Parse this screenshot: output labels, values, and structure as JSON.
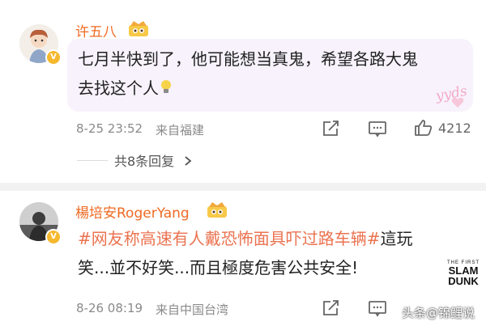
{
  "comments": [
    {
      "username": "许五八",
      "text_line1": "七月半快到了，他可能想当真鬼，希望各路大鬼",
      "text_line2": "去找这个人",
      "sticker": "yyds",
      "timestamp": "8-25 23:52",
      "location": "来自福建",
      "like_count": "4212",
      "replies_label": "共8条回复",
      "badge": "V"
    },
    {
      "username": "楊培安RogerYang",
      "hashtag": "#网友称高速有人戴恐怖面具吓过路车辆#",
      "text_after_hashtag": "這玩",
      "text_line2": "笑...並不好笑...而且極度危害公共安全!",
      "timestamp": "8-26 08:19",
      "location": "来自中国台湾",
      "badge": "V"
    }
  ],
  "icons": {
    "share": "share-icon",
    "comment": "comment-icon",
    "like": "thumbs-up-icon",
    "bulb": "lightbulb-emoji-icon",
    "crown": "vip-crown-icon",
    "chevron": "chevron-right-icon"
  },
  "watermark": {
    "text": "头条@锦鲤说"
  },
  "slamdunk_logo": {
    "line1": "THE FIRST",
    "line2": "SLAM",
    "line3": "DUNK"
  },
  "colors": {
    "username": "#ef6a22",
    "hashtag": "#eb7350",
    "bubble": "#f7f2fc",
    "badge": "#f5b82e"
  }
}
